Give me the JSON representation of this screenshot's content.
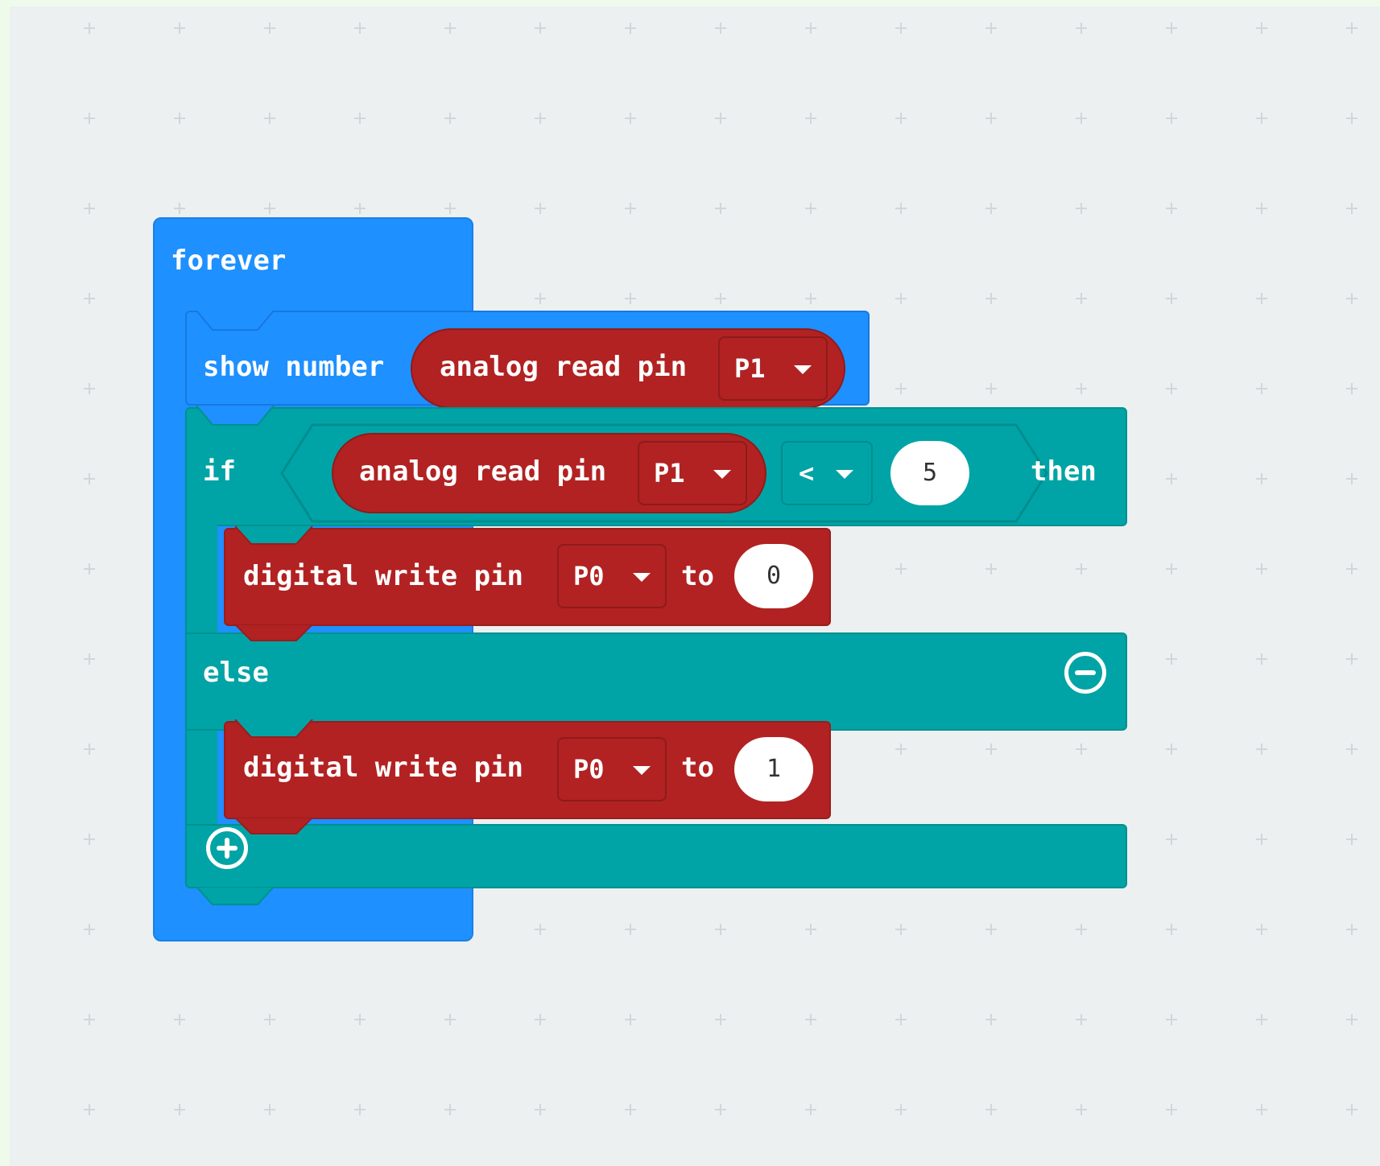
{
  "forever_block": {
    "label": "forever"
  },
  "show_number_block": {
    "label": "show number",
    "reporter": {
      "label": "analog read pin",
      "pin": "P1"
    }
  },
  "if_block": {
    "if_label": "if",
    "condition": {
      "reporter": {
        "label": "analog read pin",
        "pin": "P1"
      },
      "operator": "<",
      "value": "5"
    },
    "then_label": "then",
    "else_label": "else"
  },
  "then_statement": {
    "label": "digital write pin",
    "pin": "P0",
    "to_label": "to",
    "value": "0"
  },
  "else_statement": {
    "label": "digital write pin",
    "pin": "P0",
    "to_label": "to",
    "value": "1"
  },
  "icons": {
    "remove_else": "minus-circle-icon",
    "add_branch": "plus-circle-icon",
    "dropdown": "caret-down-icon"
  },
  "colors": {
    "loops": "#1e90ff",
    "logic": "#00a4a6",
    "pins": "#b22222",
    "workspace": "#ecf0f1",
    "frame": "#effbea"
  }
}
